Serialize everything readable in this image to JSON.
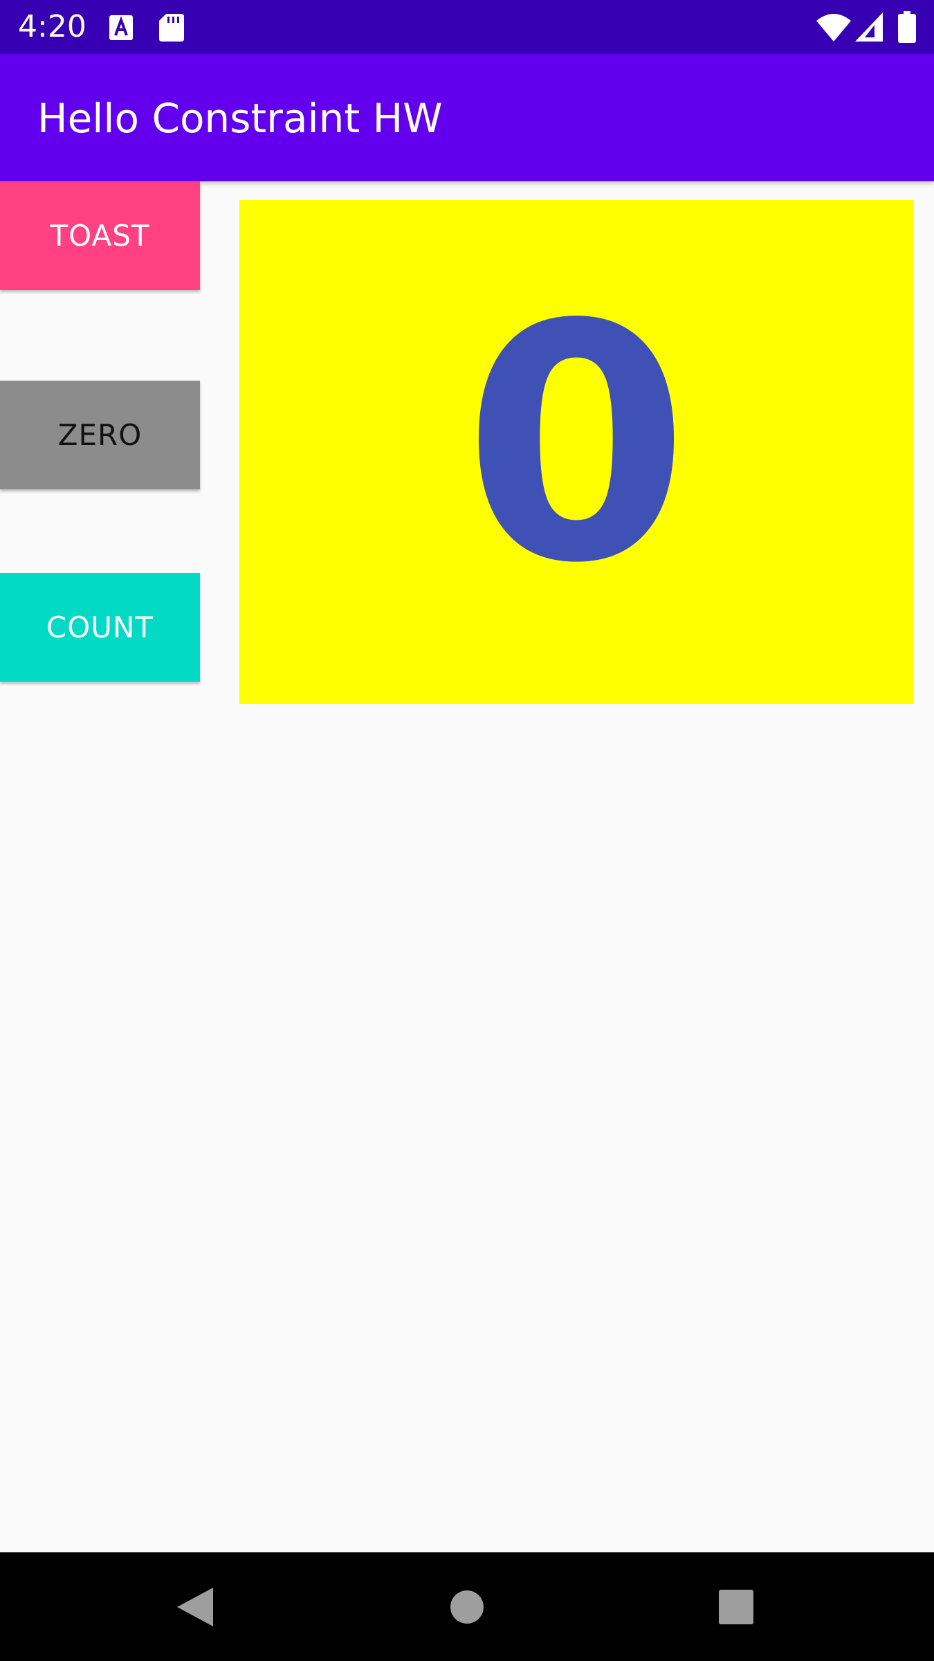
{
  "status_bar": {
    "time": "4:20",
    "icons": [
      "text-a-icon",
      "sd-card-icon",
      "wifi-icon",
      "signal-icon",
      "battery-icon"
    ],
    "background": "#3700b3"
  },
  "app_bar": {
    "title": "Hello Constraint HW",
    "background": "#6200ee"
  },
  "buttons": {
    "toast": {
      "label": "TOAST",
      "background": "#ff4081",
      "text_color": "#ffffff"
    },
    "zero": {
      "label": "ZERO",
      "background": "#8c8c8c",
      "text_color": "#111111"
    },
    "count": {
      "label": "COUNT",
      "background": "#03dac6",
      "text_color": "#ffffff"
    }
  },
  "counter": {
    "value": "0",
    "background": "#ffff00",
    "text_color": "#3f51b5"
  },
  "nav_bar": {
    "icons": [
      "back-icon",
      "home-icon",
      "recents-icon"
    ],
    "background": "#000000"
  }
}
